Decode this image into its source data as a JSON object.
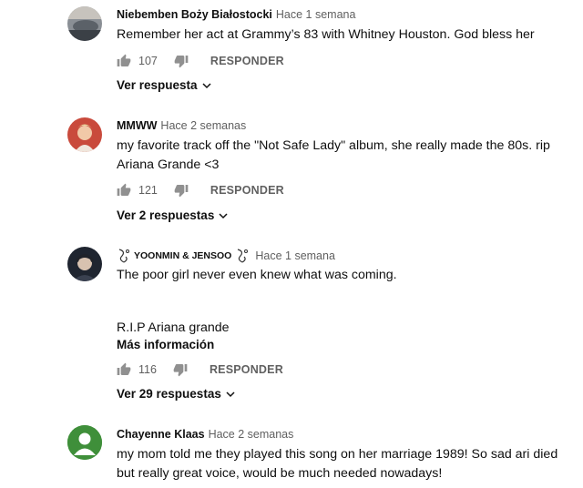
{
  "labels": {
    "reply": "RESPONDER"
  },
  "comments": [
    {
      "author": "Niebemben Boży Białostocki",
      "time": "Hace 1 semana",
      "text": "Remember her act at Grammy’s 83 with Whitney Houston. God bless her",
      "likes": "107",
      "replies": "Ver respuesta"
    },
    {
      "author": "MMWW",
      "time": "Hace 2 semanas",
      "text": "my favorite track off the \"Not Safe Lady\" album, she really made the 80s. rip Ariana Grande <3",
      "likes": "121",
      "replies": "Ver 2 respuestas"
    },
    {
      "author": "YOONMIN & JENSOO",
      "time": "Hace 1 semana",
      "text": "The poor girl never even knew what was coming.",
      "extra_line": "R.I.P Ariana grande",
      "more": "Más información",
      "likes": "116",
      "replies": "Ver 29 respuestas"
    },
    {
      "author": "Chayenne Klaas",
      "time": "Hace 2 semanas",
      "text": "my mom told me they played this song on her marriage 1989! So sad ari died but really great voice, would be much needed nowadays!"
    }
  ],
  "icons": {
    "like": "thumb-up-icon",
    "dislike": "thumb-down-icon",
    "chevron": "chevron-down-icon"
  },
  "colors": {
    "secondary_text": "#606060",
    "default_avatar": "#3f8f3a"
  }
}
